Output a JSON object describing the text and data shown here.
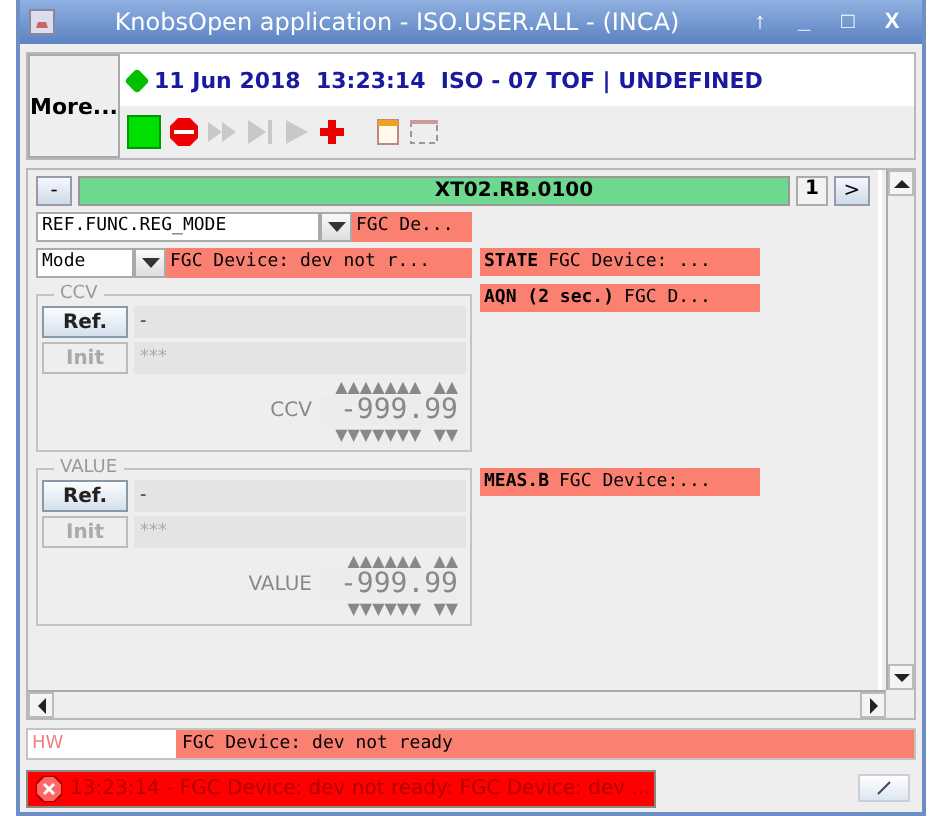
{
  "window": {
    "title": "KnobsOpen application - ISO.USER.ALL - (INCA)",
    "controls": [
      "↑",
      "_",
      "□",
      "X"
    ]
  },
  "more_button": "More...",
  "info": {
    "text": "11 Jun 2018  13:23:14  ISO - 07 TOF | UNDEFINED"
  },
  "toolbar": [
    {
      "kind": "start",
      "disabled": false
    },
    {
      "kind": "stop",
      "disabled": false
    },
    {
      "kind": "fast",
      "disabled": true
    },
    {
      "kind": "step",
      "disabled": true
    },
    {
      "kind": "play",
      "disabled": true
    },
    {
      "kind": "add",
      "disabled": false
    },
    {
      "kind": "note",
      "disabled": false
    },
    {
      "kind": "frame",
      "disabled": false
    }
  ],
  "device": {
    "collapse": "-",
    "name": "XT02.RB.0100",
    "page": "1",
    "next": ">"
  },
  "selector": {
    "value": "REF.FUNC.REG_MODE",
    "status": "FGC De..."
  },
  "mode": {
    "value": "Mode",
    "status": "FGC Device: dev not r..."
  },
  "right_fields": [
    {
      "label": "STATE",
      "value": "FGC Device: ..."
    },
    {
      "label": "AQN (2 sec.)",
      "value": "FGC D..."
    },
    {
      "label": "MEAS.B",
      "value": "FGC Device:..."
    }
  ],
  "groups": [
    {
      "title": "CCV",
      "ref": "Ref.",
      "ref_value": "-",
      "init": "Init",
      "init_value": "***",
      "init_disabled": true,
      "value_label": "CCV",
      "value": "-999.99",
      "up_int": "▲▲▲▲▲▲▲",
      "up_frac": "▲▲",
      "down_int": "▼▼▼▼▼▼▼",
      "down_frac": "▼▼"
    },
    {
      "title": "VALUE",
      "ref": "Ref.",
      "ref_value": "-",
      "init": "Init",
      "init_value": "***",
      "init_disabled": true,
      "value_label": "VALUE",
      "value": "-999.99",
      "up_int": "▲▲▲▲▲▲",
      "up_frac": "▲▲",
      "down_int": "▼▼▼▼▼▼",
      "down_frac": "▼▼"
    }
  ],
  "hw": {
    "label": "HW",
    "message": "FGC Device: dev not ready"
  },
  "status": {
    "message": "13:23:14 - FGC Device: dev not ready: FGC Device: dev ..."
  }
}
